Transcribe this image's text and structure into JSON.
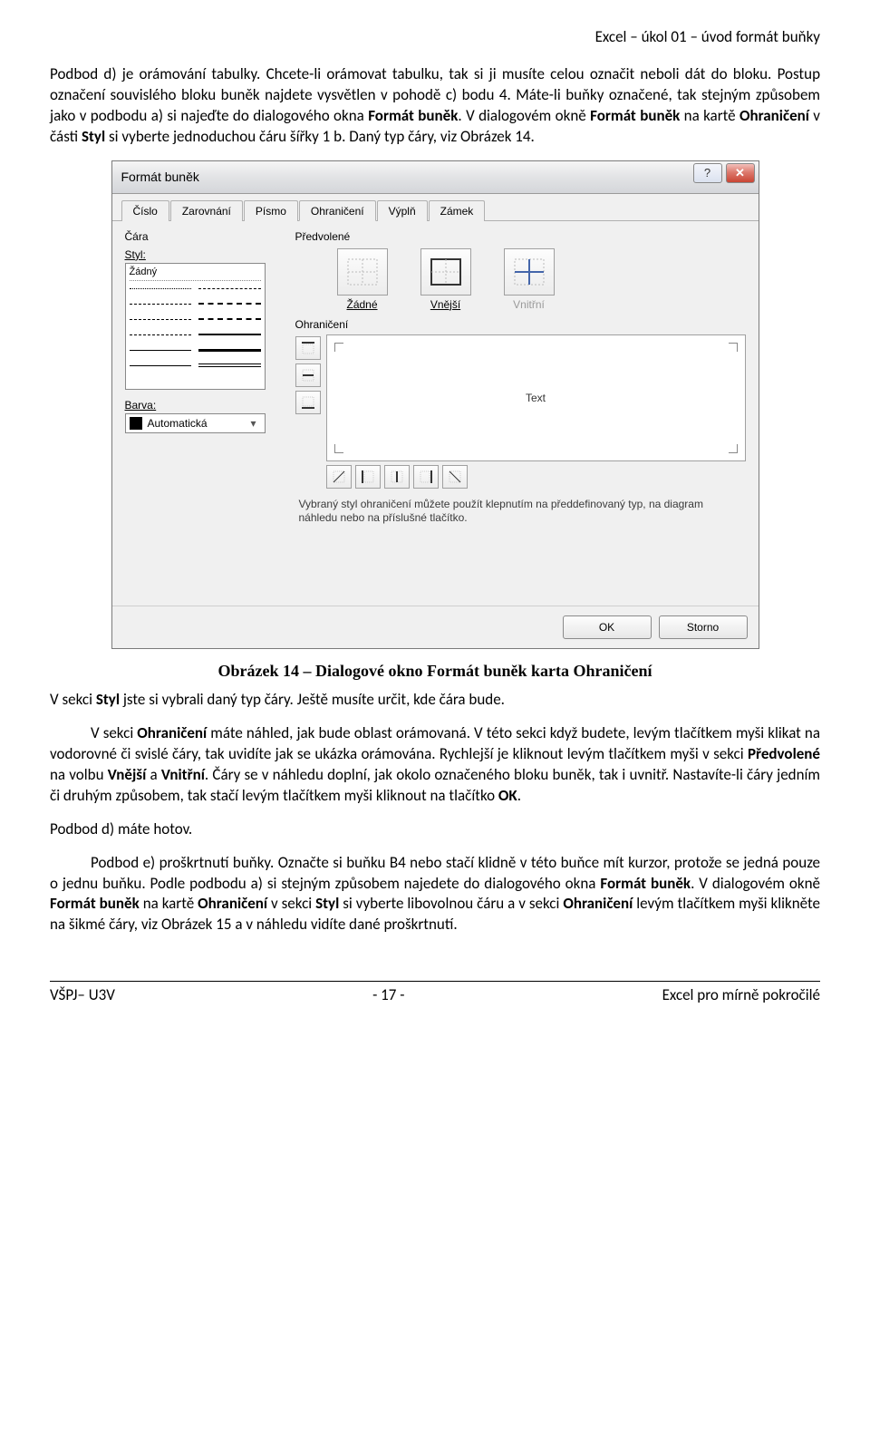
{
  "header": {
    "right": "Excel – úkol 01 – úvod formát buňky"
  },
  "para1": "Podbod d) je orámování tabulky. Chcete-li orámovat tabulku, tak si ji musíte celou označit neboli dát do bloku. Postup označení souvislého bloku buněk najdete vysvětlen v pohodě c) bodu 4. Máte-li buňky označené, tak stejným způsobem jako v podbodu a) si najeďte do dialogového okna ",
  "para1b": "Formát buněk",
  "para1c": ". V dialogovém okně ",
  "para1d": "Formát buněk",
  "para1e": " na kartě ",
  "para1f": "Ohraničení",
  "para1g": " v části ",
  "para1h": "Styl",
  "para1i": " si vyberte jednoduchou čáru šířky 1 b. Daný typ čáry, viz Obrázek 14.",
  "dialog": {
    "title": "Formát buněk",
    "help": "?",
    "close": "✕",
    "tabs": [
      "Číslo",
      "Zarovnání",
      "Písmo",
      "Ohraničení",
      "Výplň",
      "Zámek"
    ],
    "activeTab": 3,
    "line_section": "Čára",
    "style_label": "Styl:",
    "style_none": "Žádný",
    "color_label": "Barva:",
    "color_value": "Automatická",
    "presets_label": "Předvolené",
    "presets": [
      {
        "label": "Žádné"
      },
      {
        "label": "Vnější"
      },
      {
        "label": "Vnitřní"
      }
    ],
    "border_label": "Ohraničení",
    "preview_text": "Text",
    "hint": "Vybraný styl ohraničení můžete použít klepnutím na předdefinovaný typ, na diagram náhledu nebo na příslušné tlačítko.",
    "ok": "OK",
    "cancel": "Storno"
  },
  "caption": "Obrázek 14 – Dialogové okno Formát buněk karta Ohraničení",
  "para2a": "V sekci ",
  "para2b": "Styl",
  "para2c": " jste si vybrali daný typ čáry. Ještě musíte určit, kde čára bude.",
  "para3a": "V sekci ",
  "para3b": "Ohraničení",
  "para3c": " máte náhled, jak bude oblast orámovaná. V této sekci když budete, levým tlačítkem myši klikat na vodorovné či svislé čáry, tak uvidíte jak se ukázka orámována. Rychlejší je kliknout levým tlačítkem myši v sekci ",
  "para3d": "Předvolené",
  "para3e": " na volbu ",
  "para3f": "Vnější",
  "para3g": " a ",
  "para3h": "Vnitřní",
  "para3i": ". Čáry se v náhledu doplní, jak okolo označeného bloku buněk, tak i uvnitř. Nastavíte-li čáry jedním či druhým způsobem, tak stačí levým tlačítkem myši kliknout na tlačítko ",
  "para3j": "OK",
  "para3k": ".",
  "para4": "Podbod d) máte hotov.",
  "para5a": "Podbod e) proškrtnutí buňky. Označte si buňku B4 nebo stačí klidně v této buňce mít kurzor, protože se jedná pouze o jednu buňku. Podle podbodu a) si stejným způsobem najedete do dialogového okna ",
  "para5b": "Formát buněk",
  "para5c": ". V dialogovém okně ",
  "para5d": "Formát buněk",
  "para5e": " na kartě ",
  "para5f": "Ohraničení",
  "para5g": " v sekci ",
  "para5h": "Styl",
  "para5i": " si vyberte libovolnou čáru a v sekci ",
  "para5j": "Ohraničení",
  "para5k": " levým tlačítkem myši klikněte na šikmé čáry, viz Obrázek 15 a v náhledu vidíte dané proškrtnutí.",
  "footer": {
    "left": "VŠPJ– U3V",
    "mid": "- 17 -",
    "right": "Excel pro mírně pokročilé"
  }
}
